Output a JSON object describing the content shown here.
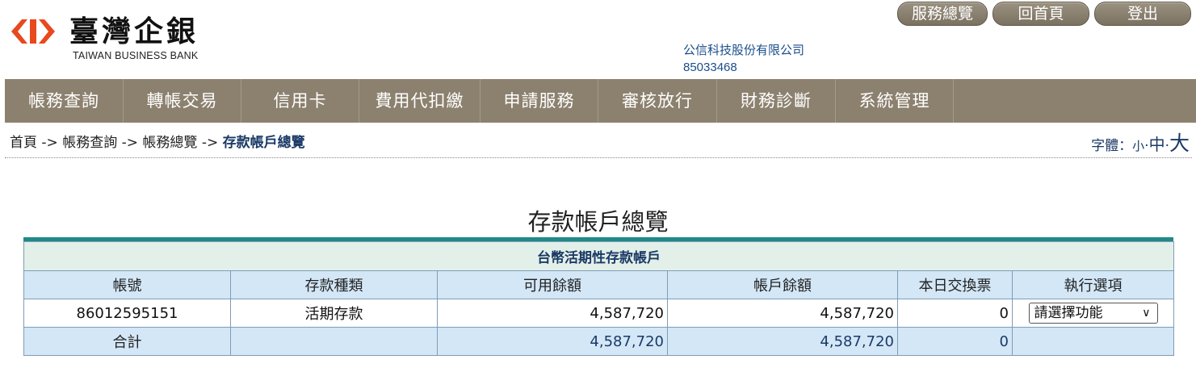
{
  "brand": {
    "name": "臺灣企銀",
    "english": "TAIWAN BUSINESS BANK",
    "color": "#e8491d"
  },
  "top_buttons": [
    "服務總覽",
    "回首頁",
    "登出"
  ],
  "company": {
    "name": "公信科技股份有限公司",
    "id": "85033468"
  },
  "nav": [
    "帳務查詢",
    "轉帳交易",
    "信用卡",
    "費用代扣繳",
    "申請服務",
    "審核放行",
    "財務診斷",
    "系統管理"
  ],
  "breadcrumb": {
    "items": [
      "首頁",
      "帳務查詢",
      "帳務總覽"
    ],
    "current": "存款帳戶總覽",
    "separator": "->"
  },
  "font_size": {
    "label": "字體：",
    "small": "小",
    "medium": "中",
    "large": "大"
  },
  "page_title": "存款帳戶總覽",
  "table": {
    "caption": "台幣活期性存款帳戶",
    "headers": [
      "帳號",
      "存款種類",
      "可用餘額",
      "帳戶餘額",
      "本日交換票",
      "執行選項"
    ],
    "rows": [
      {
        "account": "86012595151",
        "type": "活期存款",
        "available": "4,587,720",
        "balance": "4,587,720",
        "checks": "0",
        "action": "請選擇功能"
      }
    ],
    "total": {
      "label": "合計",
      "available": "4,587,720",
      "balance": "4,587,720",
      "checks": "0"
    }
  },
  "colors": {
    "nav_bg": "#8c816f",
    "accent_teal": "#1f8a87",
    "header_row": "#d3e7f7",
    "caption_row": "#e3efe9"
  }
}
